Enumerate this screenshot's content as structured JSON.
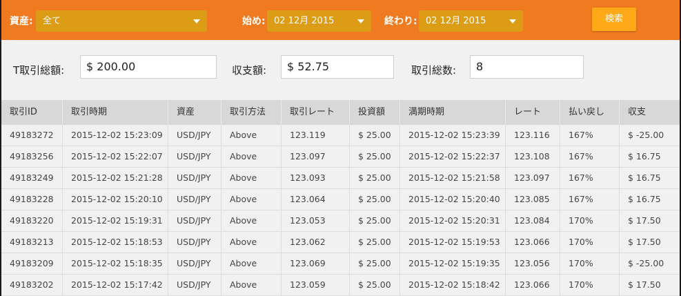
{
  "filters": {
    "asset_label": "資産:",
    "asset_value": "全て",
    "start_label": "始め:",
    "start_value": "02 12月 2015",
    "end_label": "終わり:",
    "end_value": "02 12月 2015",
    "search_label": "検索"
  },
  "summary": {
    "total_amount_label": "T取引総額:",
    "total_amount_value": "$ 200.00",
    "balance_label": "収支額:",
    "balance_value": "$ 52.75",
    "trade_count_label": "取引総数:",
    "trade_count_value": "8"
  },
  "table": {
    "headers": [
      "取引ID",
      "取引時期",
      "資産",
      "取引方法",
      "取引レート",
      "投資額",
      "満期時期",
      "レート",
      "払い戻し",
      "収支"
    ],
    "rows": [
      [
        "49183272",
        "2015-12-02 15:23:09",
        "USD/JPY",
        "Above",
        "123.119",
        "$ 25.00",
        "2015-12-02 15:23:39",
        "123.116",
        "167%",
        "$ -25.00"
      ],
      [
        "49183256",
        "2015-12-02 15:22:07",
        "USD/JPY",
        "Above",
        "123.097",
        "$ 25.00",
        "2015-12-02 15:22:37",
        "123.108",
        "167%",
        "$ 16.75"
      ],
      [
        "49183249",
        "2015-12-02 15:21:28",
        "USD/JPY",
        "Above",
        "123.093",
        "$ 25.00",
        "2015-12-02 15:21:58",
        "123.097",
        "167%",
        "$ 16.75"
      ],
      [
        "49183228",
        "2015-12-02 15:20:10",
        "USD/JPY",
        "Above",
        "123.064",
        "$ 25.00",
        "2015-12-02 15:20:40",
        "123.085",
        "167%",
        "$ 16.75"
      ],
      [
        "49183220",
        "2015-12-02 15:19:31",
        "USD/JPY",
        "Above",
        "123.053",
        "$ 25.00",
        "2015-12-02 15:20:31",
        "123.084",
        "170%",
        "$ 17.50"
      ],
      [
        "49183213",
        "2015-12-02 15:18:53",
        "USD/JPY",
        "Above",
        "123.062",
        "$ 25.00",
        "2015-12-02 15:19:53",
        "123.066",
        "170%",
        "$ 17.50"
      ],
      [
        "49183209",
        "2015-12-02 15:18:35",
        "USD/JPY",
        "Above",
        "123.069",
        "$ 25.00",
        "2015-12-02 15:19:35",
        "123.056",
        "170%",
        "$ -25.00"
      ],
      [
        "49183202",
        "2015-12-02 15:17:42",
        "USD/JPY",
        "Above",
        "123.059",
        "$ 25.00",
        "2015-12-02 15:18:42",
        "123.066",
        "170%",
        "$ 17.50"
      ]
    ]
  },
  "colors": {
    "header_bar": "#f07a1f",
    "select_bg": "#dc9c15",
    "search_button": "#ffa818"
  }
}
